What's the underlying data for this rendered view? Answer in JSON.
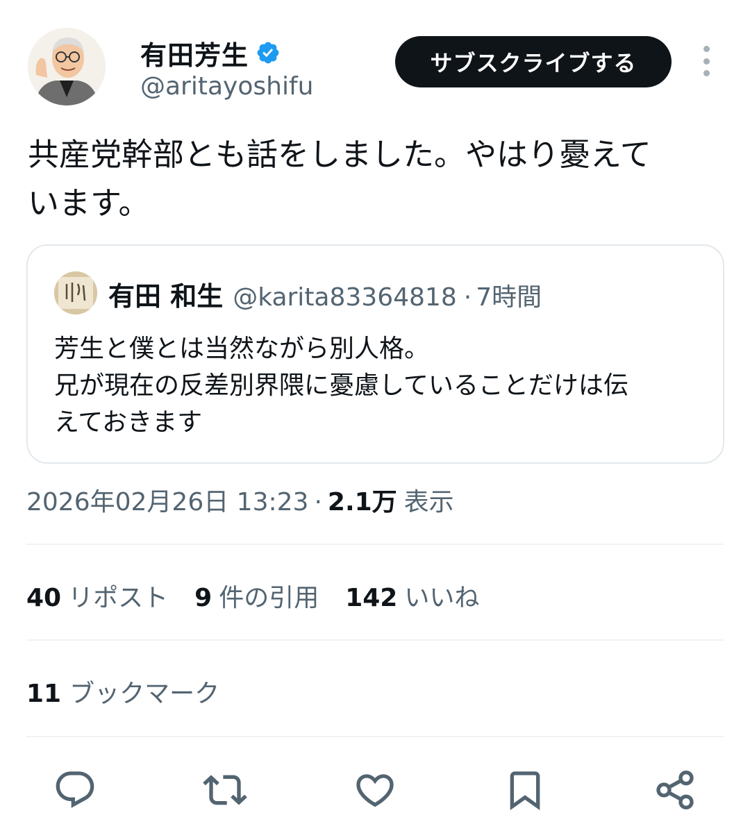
{
  "author": {
    "display_name": "有田芳生",
    "handle": "@aritayoshifu",
    "verified_icon": "verified-badge-icon"
  },
  "subscribe_label": "サブスクライブする",
  "tweet_text_line1": "共産党幹部とも話をしました。やはり憂えて",
  "tweet_text_line2": "います。",
  "quote": {
    "display_name": "有田 和生",
    "handle": "@karita83364818",
    "separator": "·",
    "time": "7時間",
    "text_line1": "芳生と僕とは当然ながら別人格。",
    "text_line2": "兄が現在の反差別界隈に憂慮していることだけは伝",
    "text_line3": "えておきます"
  },
  "meta": {
    "timestamp": "2026年02月26日 13:23",
    "separator": "·",
    "views_count": "2.1万",
    "views_label": "表示"
  },
  "stats": {
    "reposts_count": "40",
    "reposts_label": "リポスト",
    "quotes_count": "9",
    "quotes_label": "件の引用",
    "likes_count": "142",
    "likes_label": "いいね",
    "bookmarks_count": "11",
    "bookmarks_label": "ブックマーク"
  },
  "colors": {
    "text_primary": "#0f1419",
    "text_secondary": "#536471",
    "verified_blue": "#1d9bf0",
    "icon_gray": "#536471",
    "divider": "#eff3f4"
  },
  "actions": [
    "reply-icon",
    "retweet-icon",
    "like-icon",
    "bookmark-icon",
    "share-icon"
  ]
}
